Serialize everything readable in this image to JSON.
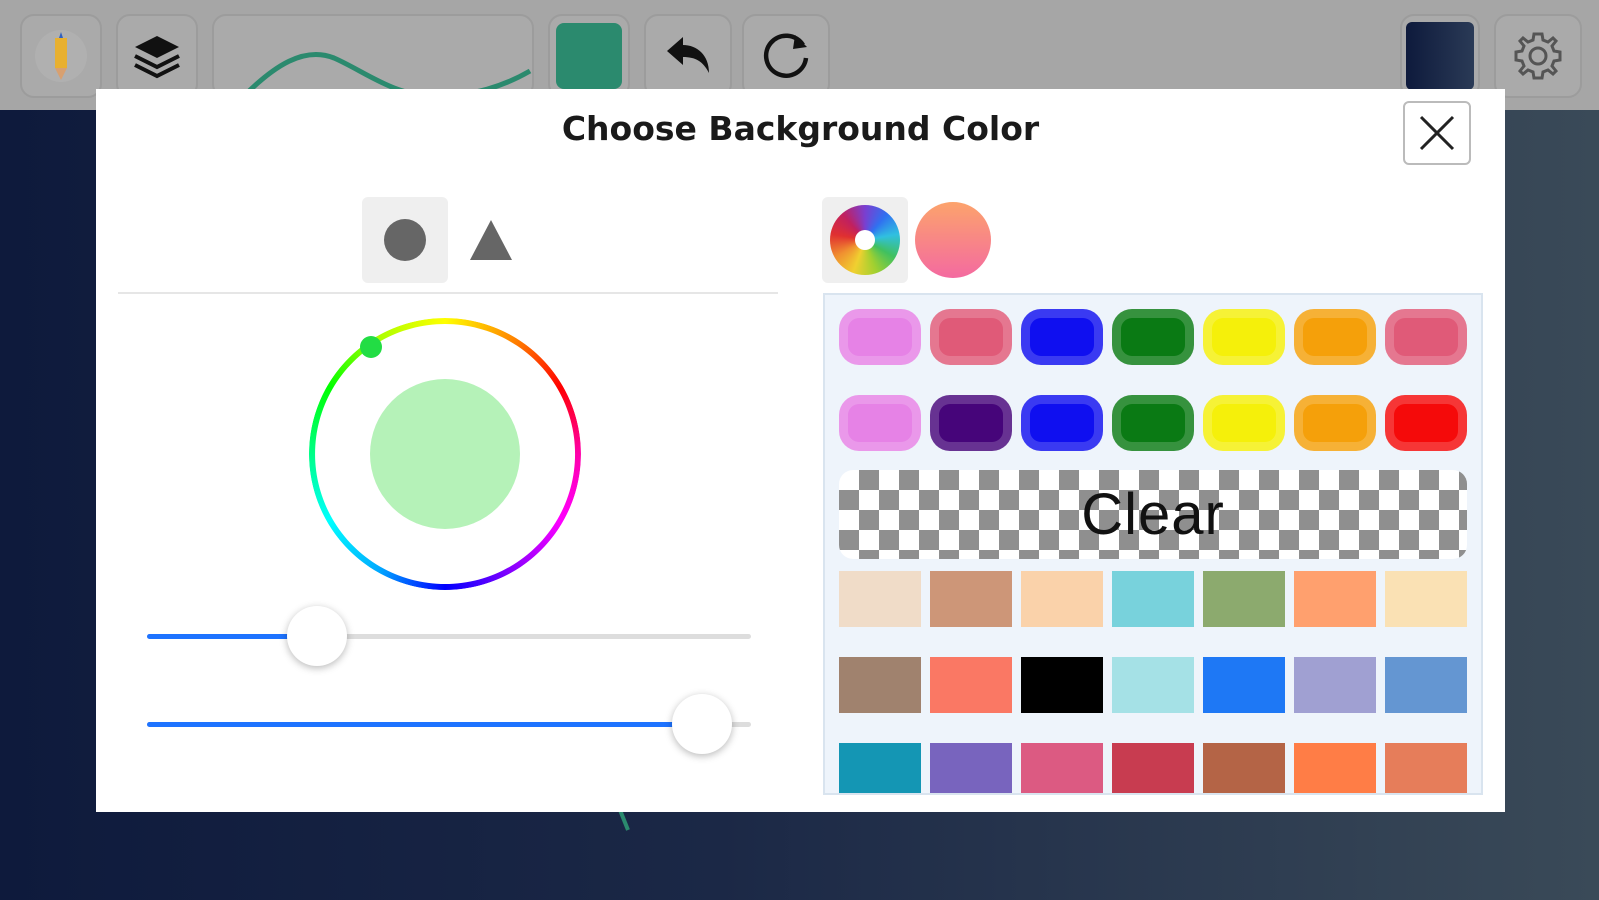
{
  "dialog": {
    "title": "Choose Background Color"
  },
  "toolbar": {
    "items": [
      {
        "name": "pencil-tool",
        "icon": "pencil-icon"
      },
      {
        "name": "layers",
        "icon": "layers-icon"
      },
      {
        "name": "brush-preview",
        "icon": "stroke-preview"
      },
      {
        "name": "stroke-color",
        "color": "#2b8a6e"
      },
      {
        "name": "undo",
        "icon": "undo-icon"
      },
      {
        "name": "redo",
        "icon": "redo-icon"
      },
      {
        "name": "background-color",
        "color": "#1b2a4a"
      },
      {
        "name": "settings",
        "icon": "gear-icon"
      }
    ]
  },
  "left_panel": {
    "shape_tabs": [
      {
        "name": "circle",
        "icon": "circle-icon",
        "active": true
      },
      {
        "name": "triangle",
        "icon": "triangle-icon",
        "active": false
      }
    ],
    "selected_color": "#b5f2b8",
    "sliders": [
      {
        "name": "saturation",
        "value": 0.28
      },
      {
        "name": "lightness",
        "value": 0.92
      }
    ]
  },
  "right_panel": {
    "mode_tabs": [
      {
        "name": "color-wheel",
        "icon": "color-wheel-icon",
        "active": true
      },
      {
        "name": "gradient",
        "icon": "gradient-icon",
        "active": false
      }
    ],
    "pill_rows": [
      [
        "#e682e6",
        "#e05a78",
        "#0f0ff0",
        "#0a7a14",
        "#f5f00a",
        "#f5a00a",
        "#e05a78"
      ],
      [
        "#e682e6",
        "#46057a",
        "#0f0ff0",
        "#0a7a14",
        "#f5f00a",
        "#f5a00a",
        "#f50a0a"
      ]
    ],
    "clear_label": "Clear",
    "swatch_rows": [
      [
        "#f0dcc8",
        "#cd9678",
        "#fad2aa",
        "#78d2dc",
        "#8caa6e",
        "#ffa06e",
        "#fae1b4"
      ],
      [
        "#a0826e",
        "#fa7864",
        "#000000",
        "#a5e1e6",
        "#1e78f5",
        "#a0a0d2",
        "#6496d2"
      ],
      [
        "#1496b4",
        "#7864be",
        "#dc5a82",
        "#c83c50",
        "#b46446",
        "#ff7d46",
        "#e67d5a"
      ]
    ]
  }
}
